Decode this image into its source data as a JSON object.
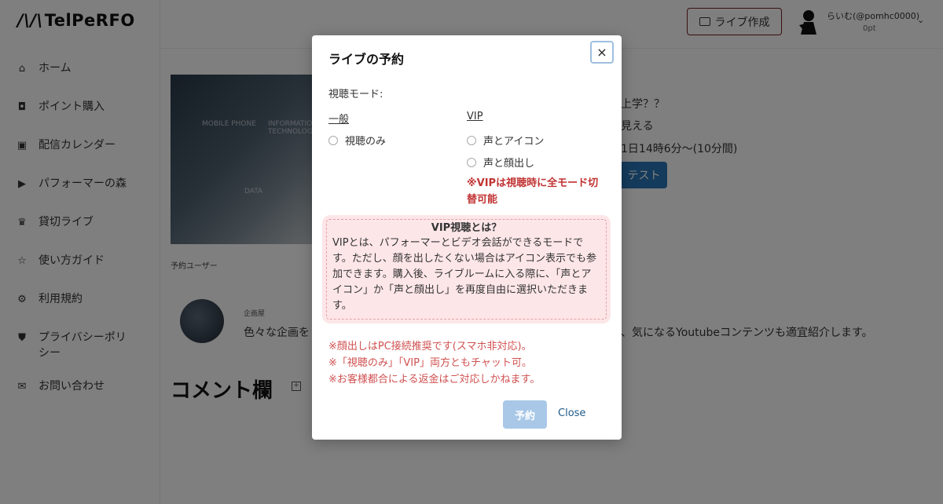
{
  "app": {
    "logo_text": "TelPeRFO",
    "logo_mark": "/\\/\\"
  },
  "sidebar": {
    "items": [
      {
        "label": "ホーム",
        "icon": "home-icon"
      },
      {
        "label": "ポイント購入",
        "icon": "coin-icon"
      },
      {
        "label": "配信カレンダー",
        "icon": "calendar-icon"
      },
      {
        "label": "パフォーマーの森",
        "icon": "video-icon"
      },
      {
        "label": "貸切ライブ",
        "icon": "crown-icon"
      },
      {
        "label": "使い方ガイド",
        "icon": "star-icon"
      },
      {
        "label": "利用規約",
        "icon": "gear-icon"
      },
      {
        "label": "プライバシーポリシー",
        "icon": "shield-icon"
      },
      {
        "label": "お問い合わせ",
        "icon": "mail-icon"
      }
    ]
  },
  "header": {
    "create_live_label": "ライブ作成",
    "user_name": "らいむ(@pomhc0000)",
    "user_points": "0pt"
  },
  "page": {
    "hero_words": [
      "MOBILE PHONE",
      "INFORMATION TECHNOLOGY",
      "DATA"
    ],
    "reserve_users_label": "予約ユーザー",
    "info_lines": [
      "上学？？",
      "見える",
      "1日14時6分～(10分間)"
    ],
    "test_label": "テスト",
    "organizer_label": "企画屋",
    "organizer_desc_left": "色々な企画を",
    "organizer_desc_right": "、気になるYoutubeコンテンツも適宜紹介します。",
    "comments_title": "コメント欄"
  },
  "modal": {
    "title": "ライブの予約",
    "close_symbol": "×",
    "mode_label": "視聴モード:",
    "general_heading": "一般",
    "general_options": [
      "視聴のみ"
    ],
    "vip_heading": "VIP",
    "vip_options": [
      "声とアイコン",
      "声と顔出し"
    ],
    "vip_note": "※VIPは視聴時に全モード切替可能",
    "vip_info_title": "VIP視聴とは？",
    "vip_info_body": "VIPとは、パフォーマーとビデオ会話ができるモードです。ただし、顔を出したくない場合はアイコン表示でも参加できます。購入後、ライブルームに入る際に、「声とアイコン」か「声と顔出し」を再度自由に選択いただきます。",
    "notes": [
      "※顔出しはPC接続推奨です(スマホ非対応)。",
      "※「視聴のみ」「VIP」両方ともチャット可。",
      "※お客様都合による返金はご対応しかねます。"
    ],
    "reserve_label": "予約",
    "close_label": "Close"
  }
}
